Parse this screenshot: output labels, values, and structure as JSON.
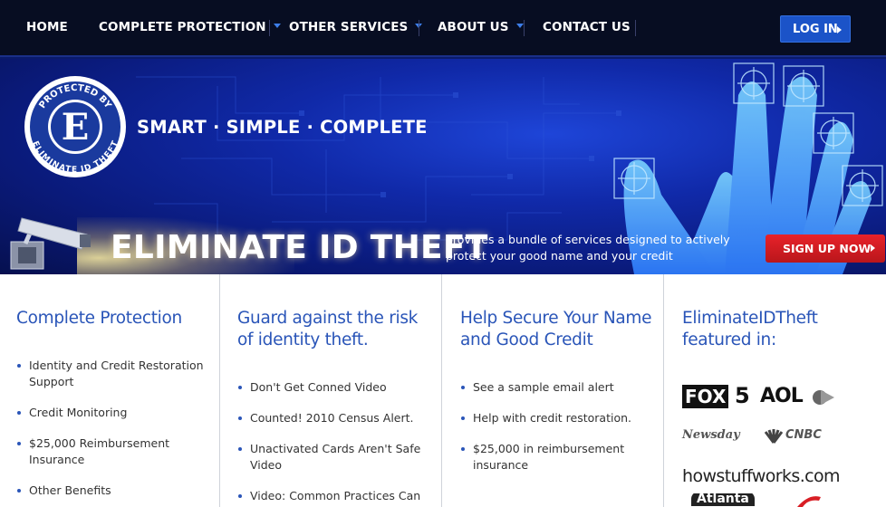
{
  "nav": {
    "items": [
      {
        "label": "HOME",
        "dropdown": false
      },
      {
        "label": "COMPLETE PROTECTION",
        "dropdown": true
      },
      {
        "label": "OTHER SERVICES",
        "dropdown": true
      },
      {
        "label": "ABOUT US",
        "dropdown": true
      },
      {
        "label": "CONTACT US",
        "dropdown": false
      }
    ],
    "login_label": "LOG IN"
  },
  "hero": {
    "badge_top": "PROTECTED BY",
    "badge_bottom": "ELIMINATE ID THEFT",
    "badge_letter": "E",
    "tagline": "SMART · SIMPLE · COMPLETE",
    "title": "ELIMINATE ID THEFT",
    "description": "provides a bundle of services designed to actively protect your good name and your credit",
    "signup_label": "SIGN UP NOW"
  },
  "columns": [
    {
      "heading": "Complete Protection",
      "items": [
        "Identity and Credit Restoration Support",
        "Credit Monitoring",
        "$25,000 Reimbursement Insurance",
        "Other Benefits"
      ]
    },
    {
      "heading": "Guard against the risk of identity theft.",
      "items": [
        "Don't Get Conned Video",
        "Counted! 2010 Census Alert.",
        "Unactivated Cards Aren't Safe Video",
        "Video: Common Practices Can"
      ]
    },
    {
      "heading": "Help Secure Your Name and Good Credit",
      "items": [
        "See a sample email alert",
        "Help with credit restoration.",
        "$25,000 in reimbursement insurance"
      ]
    },
    {
      "heading": "EliminateIDTheft featured in:",
      "logos": {
        "fox": "FOX",
        "fox_num": "5",
        "aol": "AOL",
        "newsday": "Newsday",
        "cnbc": "CNBC",
        "hsw": "howstuffworks.com",
        "atlanta": "Atlanta"
      }
    }
  ],
  "colors": {
    "nav_bg": "#070d22",
    "accent_blue": "#2a55b8",
    "login_bg": "#1b53c8",
    "signup_red": "#d81e25",
    "hero_blue": "#1029a8"
  }
}
